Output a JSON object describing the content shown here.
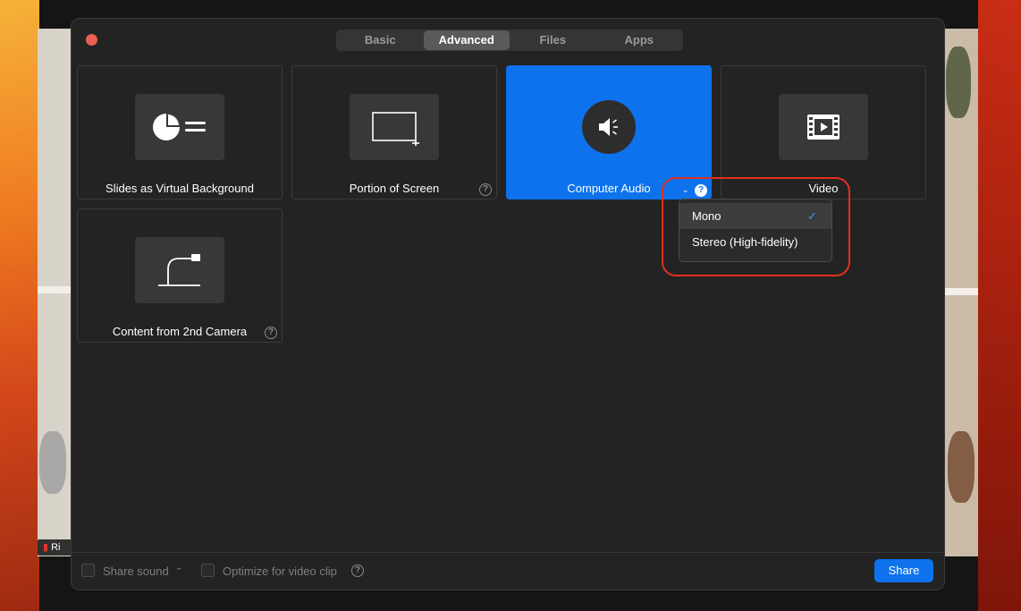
{
  "tabs": [
    {
      "label": "Basic"
    },
    {
      "label": "Advanced"
    },
    {
      "label": "Files"
    },
    {
      "label": "Apps"
    }
  ],
  "active_tab": "Advanced",
  "options": [
    {
      "label": "Slides as Virtual Background",
      "icon": "slides-background-icon"
    },
    {
      "label": "Portion of Screen",
      "icon": "screen-portion-icon"
    },
    {
      "label": "Computer Audio",
      "icon": "speaker-icon"
    },
    {
      "label": "Video",
      "icon": "film-icon"
    },
    {
      "label": "Content from 2nd Camera",
      "icon": "document-camera-icon"
    }
  ],
  "selected_option": "Computer Audio",
  "audio_menu": {
    "items": [
      {
        "label": "Mono",
        "checked": true
      },
      {
        "label": "Stereo (High-fidelity)",
        "checked": false
      }
    ]
  },
  "footer": {
    "share_sound": "Share sound",
    "optimize": "Optimize for video clip",
    "share_button": "Share"
  },
  "participant_tag": "Ri",
  "colors": {
    "accent": "#0e72ed",
    "highlight": "#e3301d",
    "dialog_bg": "#232323"
  }
}
